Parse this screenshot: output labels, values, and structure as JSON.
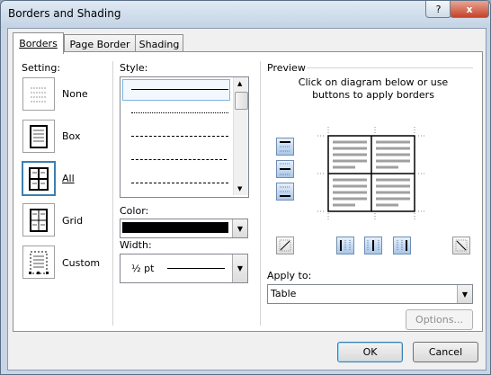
{
  "window": {
    "title": "Borders and Shading"
  },
  "titlebar": {
    "help_label": "?",
    "close_label": "x"
  },
  "tabs": [
    {
      "label": "Borders"
    },
    {
      "label": "Page Border"
    },
    {
      "label": "Shading"
    }
  ],
  "setting": {
    "label": "Setting:",
    "items": [
      {
        "label": "None"
      },
      {
        "label": "Box"
      },
      {
        "label": "All"
      },
      {
        "label": "Grid"
      },
      {
        "label": "Custom"
      }
    ],
    "selected": "All"
  },
  "style": {
    "label": "Style:",
    "lines": [
      "solid",
      "dotted",
      "dashed",
      "dashed-long",
      "dash-dot"
    ]
  },
  "color": {
    "label": "Color:",
    "value": "#000000"
  },
  "width": {
    "label": "Width:",
    "value": "½ pt"
  },
  "preview": {
    "label": "Preview",
    "instructions": "Click on diagram below or use buttons to apply borders"
  },
  "apply_to": {
    "label": "Apply to:",
    "value": "Table"
  },
  "buttons": {
    "options": "Options...",
    "ok": "OK",
    "cancel": "Cancel"
  }
}
